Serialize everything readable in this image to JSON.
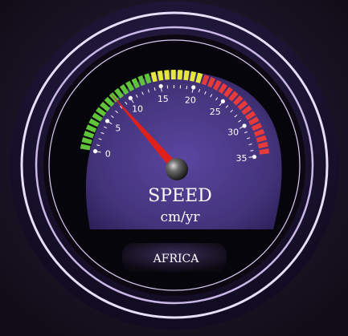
{
  "gauge": {
    "title": "SPEED",
    "unit": "cm/yr",
    "region": "AFRICA",
    "value": 8.2,
    "min": 0,
    "max": 35,
    "tick_labels": [
      "0",
      "5",
      "10",
      "15",
      "20",
      "25",
      "30",
      "35"
    ],
    "zones": [
      {
        "name": "green",
        "color": "#5fc43a"
      },
      {
        "name": "yellow",
        "color": "#e5e83a"
      },
      {
        "name": "red",
        "color": "#e83a3a"
      }
    ],
    "colors": {
      "face": "#4d3a85",
      "needle": "#e0201a",
      "bezel": "#c9b8e8",
      "background": "#16111d"
    }
  }
}
